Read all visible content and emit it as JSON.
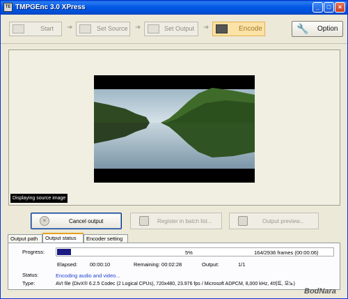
{
  "window": {
    "title": "TMPGEnc 3.0 XPress",
    "icon": "app-icon",
    "icon_text": "TE"
  },
  "title_buttons": {
    "minimize": "_",
    "maximize": "□",
    "close": "×"
  },
  "steps": [
    {
      "label": "Start",
      "icon": "start-icon"
    },
    {
      "label": "Set Source",
      "icon": "source-icon"
    },
    {
      "label": "Set Output",
      "icon": "output-icon"
    },
    {
      "label": "Encode",
      "icon": "encode-icon",
      "active": true
    }
  ],
  "arrow_glyph": "➜",
  "option_button": {
    "label": "Option",
    "icon": "wrench-icon"
  },
  "preview": {
    "overlay_label": "Displaying source image"
  },
  "actions": {
    "cancel": "Cancel output",
    "register": "Register in batch list...",
    "preview": "Output preview..."
  },
  "tabs": [
    {
      "label": "Output path"
    },
    {
      "label": "Output status",
      "active": true
    },
    {
      "label": "Encoder setting"
    }
  ],
  "status_panel": {
    "progress_label": "Progress:",
    "progress_fraction": 0.05,
    "progress_percent": "5%",
    "frames": "164/2936  frames (00:00:06)",
    "elapsed_label": "Elapsed:",
    "elapsed_value": "00:00:10",
    "remaining_label": "Remaining: 00:02:28",
    "output_label": "Output:",
    "output_value": "1/1",
    "status_label": "Status:",
    "status_value": "Encoding audio and video...",
    "type_label": "Type:",
    "type_value": "AVI file (DivX® 6.2.5 Codec (2 Logical CPUs), 720x480, 23.976 fps / Microsoft ADPCM, 8,000 kHz, 4비트, 모노)"
  },
  "watermark": "BodNara",
  "colors": {
    "accent": "#0054e3",
    "progress": "#1a1a82",
    "status_text": "#1c3fcf",
    "active_tab": "#e6a01a"
  }
}
